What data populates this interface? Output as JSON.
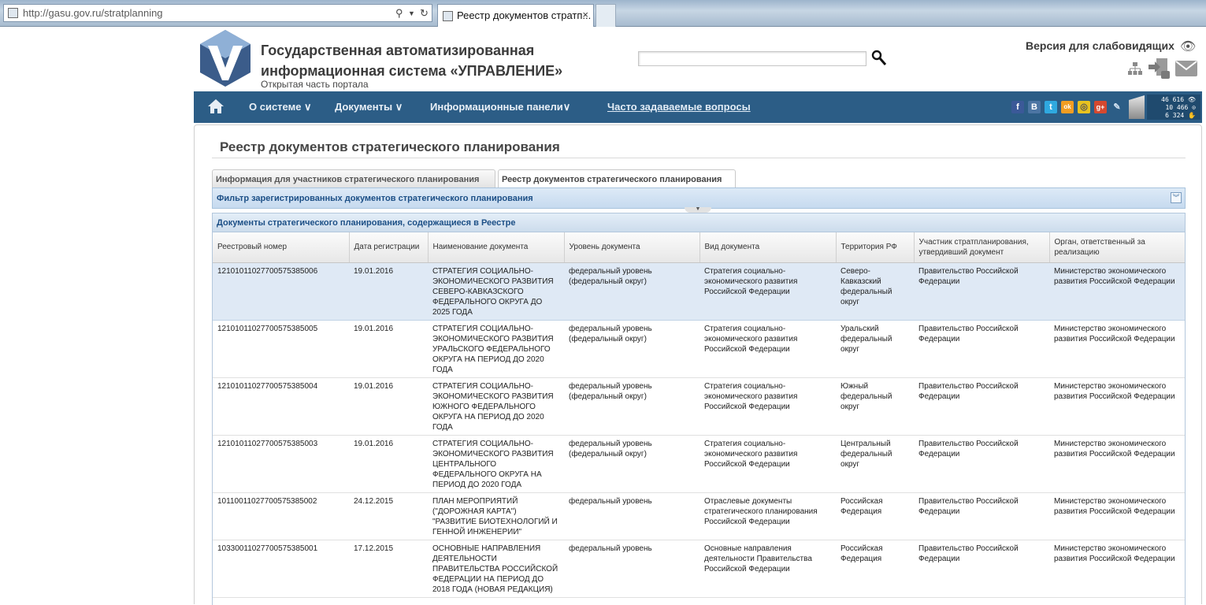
{
  "browser": {
    "url": "http://gasu.gov.ru/stratplanning",
    "tab_title": "Реестр документов стратп...",
    "tab_close": "×"
  },
  "header": {
    "title_line1": "Государственная автоматизированная",
    "title_line2": "информационная система «УПРАВЛЕНИЕ»",
    "subtitle": "Открытая часть портала",
    "search_value": "",
    "vision_link": "Версия для слабовидящих"
  },
  "nav": {
    "items": [
      "О системе ∨",
      "Документы ∨",
      "Информационные панели∨"
    ],
    "faq": "Часто задаваемые вопросы",
    "social": [
      "f",
      "B",
      "t",
      "ok",
      "◎",
      "g+",
      "✎"
    ],
    "counters": [
      "46 616 👁",
      "10 466 ⊙",
      "6 324 ✋"
    ]
  },
  "main": {
    "page_title": "Реестр документов стратегического планирования",
    "tabs": [
      "Информация для участников стратегического планирования",
      "Реестр документов стратегического планирования"
    ],
    "filter_label": "Фильтр зарегистрированных документов стратегического планирования",
    "grid_caption": "Документы стратегического планирования, содержащиеся в Реестре",
    "columns": [
      "Реестровый номер",
      "Дата регистрации",
      "Наименование документа",
      "Уровень документа",
      "Вид документа",
      "Территория РФ",
      "Участник стратпланирования, утвердивший документ",
      "Орган, ответственный за реализацию"
    ],
    "rows": [
      [
        "121010110277005753850​06",
        "19.01.2016",
        "СТРАТЕГИЯ СОЦИАЛЬНО-ЭКОНОМИЧЕСКОГО РАЗВИТИЯ СЕВЕРО-КАВКАЗСКОГО ФЕДЕРАЛЬНОГО ОКРУГА ДО 2025 ГОДА",
        "федеральный уровень (федеральный округ)",
        "Стратегия социально-экономического развития Российской Федерации",
        "Северо-Кавказский федеральный округ",
        "Правительство Российской Федерации",
        "Министерство экономического развития Российской Федерации"
      ],
      [
        "12101011027700575385005",
        "19.01.2016",
        "СТРАТЕГИЯ СОЦИАЛЬНО-ЭКОНОМИЧЕСКОГО РАЗВИТИЯ УРАЛЬСКОГО ФЕДЕРАЛЬНОГО ОКРУГА НА ПЕРИОД ДО 2020 ГОДА",
        "федеральный уровень (федеральный округ)",
        "Стратегия социально-экономического развития Российской Федерации",
        "Уральский федеральный округ",
        "Правительство Российской Федерации",
        "Министерство экономического развития Российской Федерации"
      ],
      [
        "12101011027700575385004",
        "19.01.2016",
        "СТРАТЕГИЯ СОЦИАЛЬНО-ЭКОНОМИЧЕСКОГО РАЗВИТИЯ ЮЖНОГО ФЕДЕРАЛЬНОГО ОКРУГА НА ПЕРИОД ДО 2020 ГОДА",
        "федеральный уровень (федеральный округ)",
        "Стратегия социально-экономического развития Российской Федерации",
        "Южный федеральный округ",
        "Правительство Российской Федерации",
        "Министерство экономического развития Российской Федерации"
      ],
      [
        "12101011027700575385003",
        "19.01.2016",
        "СТРАТЕГИЯ СОЦИАЛЬНО-ЭКОНОМИЧЕСКОГО РАЗВИТИЯ ЦЕНТРАЛЬНОГО ФЕДЕРАЛЬНОГО ОКРУГА НА ПЕРИОД ДО 2020 ГОДА",
        "федеральный уровень (федеральный округ)",
        "Стратегия социально-экономического развития Российской Федерации",
        "Центральный федеральный округ",
        "Правительство Российской Федерации",
        "Министерство экономического развития Российской Федерации"
      ],
      [
        "10110011027700575385002",
        "24.12.2015",
        "ПЛАН МЕРОПРИЯТИЙ (\"ДОРОЖНАЯ КАРТА\") \"РАЗВИТИЕ БИОТЕХНОЛОГИЙ И ГЕННОЙ ИНЖЕНЕРИИ\"",
        "федеральный уровень",
        "Отраслевые документы стратегического планирования Российской Федерации",
        "Российская Федерация",
        "Правительство Российской Федерации",
        "Министерство экономического развития Российской Федерации"
      ],
      [
        "10330011027700575385001",
        "17.12.2015",
        "ОСНОВНЫЕ НАПРАВЛЕНИЯ ДЕЯТЕЛЬНОСТИ ПРАВИТЕЛЬСТВА РОССИЙСКОЙ ФЕДЕРАЦИИ НА ПЕРИОД ДО 2018 ГОДА (НОВАЯ РЕДАКЦИЯ)",
        "федеральный уровень",
        "Основные направления деятельности Правительства Российской Федерации",
        "Российская Федерация",
        "Правительство Российской Федерации",
        "Министерство экономического развития Российской Федерации"
      ]
    ],
    "selected_row": 0
  },
  "colors": {
    "nav_bg": "#2c5d86",
    "accent_blue": "#1c4f86",
    "selected_row": "#dfe9f5"
  }
}
